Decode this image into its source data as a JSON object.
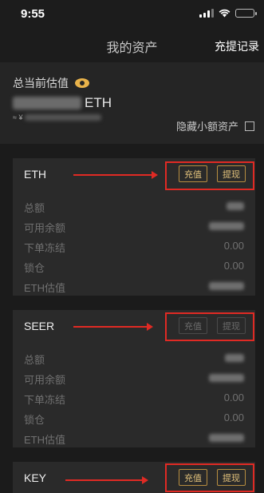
{
  "status": {
    "time": "9:55"
  },
  "nav": {
    "title": "我的资产",
    "right_action": "充提记录"
  },
  "summary": {
    "label": "总当前估值",
    "unit": "ETH",
    "approx_prefix": "≈ ¥",
    "hide_small_label": "隐藏小额资产",
    "hide_small_checked": false
  },
  "cards": [
    {
      "symbol": "ETH",
      "deposit_label": "充值",
      "withdraw_label": "提现",
      "enabled": true,
      "rows": [
        {
          "label": "总额",
          "value": null
        },
        {
          "label": "可用余额",
          "value": null
        },
        {
          "label": "下单冻结",
          "value": "0.00"
        },
        {
          "label": "锁仓",
          "value": "0.00"
        },
        {
          "label": "ETH估值",
          "value": null
        }
      ]
    },
    {
      "symbol": "SEER",
      "deposit_label": "充值",
      "withdraw_label": "提现",
      "enabled": false,
      "rows": [
        {
          "label": "总额",
          "value": null
        },
        {
          "label": "可用余额",
          "value": null
        },
        {
          "label": "下单冻结",
          "value": "0.00"
        },
        {
          "label": "锁仓",
          "value": "0.00"
        },
        {
          "label": "ETH估值",
          "value": null
        }
      ]
    },
    {
      "symbol": "KEY",
      "deposit_label": "充值",
      "withdraw_label": "提现",
      "enabled": true,
      "rows": []
    }
  ],
  "colors": {
    "background": "#1b1b1b",
    "card": "#2a2a2a",
    "accent": "#e3c27b",
    "annotation": "#e02a24"
  },
  "icons": {
    "visibility": "eye-icon",
    "signal": "cellular-signal-icon",
    "wifi": "wifi-icon",
    "battery": "battery-icon"
  }
}
